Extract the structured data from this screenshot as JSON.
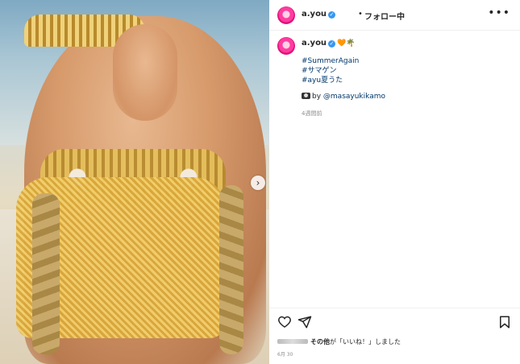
{
  "header": {
    "username": "a.you",
    "separator": "•",
    "follow_label": "フォロー中",
    "more_icon": "more-horizontal-icon"
  },
  "caption": {
    "username": "a.you",
    "emoji": "🧡🌴",
    "hashtags": [
      "#SummerAgain",
      "#サマゲン",
      "#ayu夏うた"
    ],
    "credit_prefix": "by ",
    "credit_handle": "@masayukikamo",
    "time_ago": "4週間前"
  },
  "footer": {
    "likes_suffix_bold": "その他",
    "likes_text": "が「いいね！」しました",
    "date": "6月 30"
  },
  "colors": {
    "link": "#00376b",
    "text": "#262626",
    "muted": "#8e8e8e",
    "verified": "#3897f0",
    "avatar_pink": "#ff3ca0"
  }
}
